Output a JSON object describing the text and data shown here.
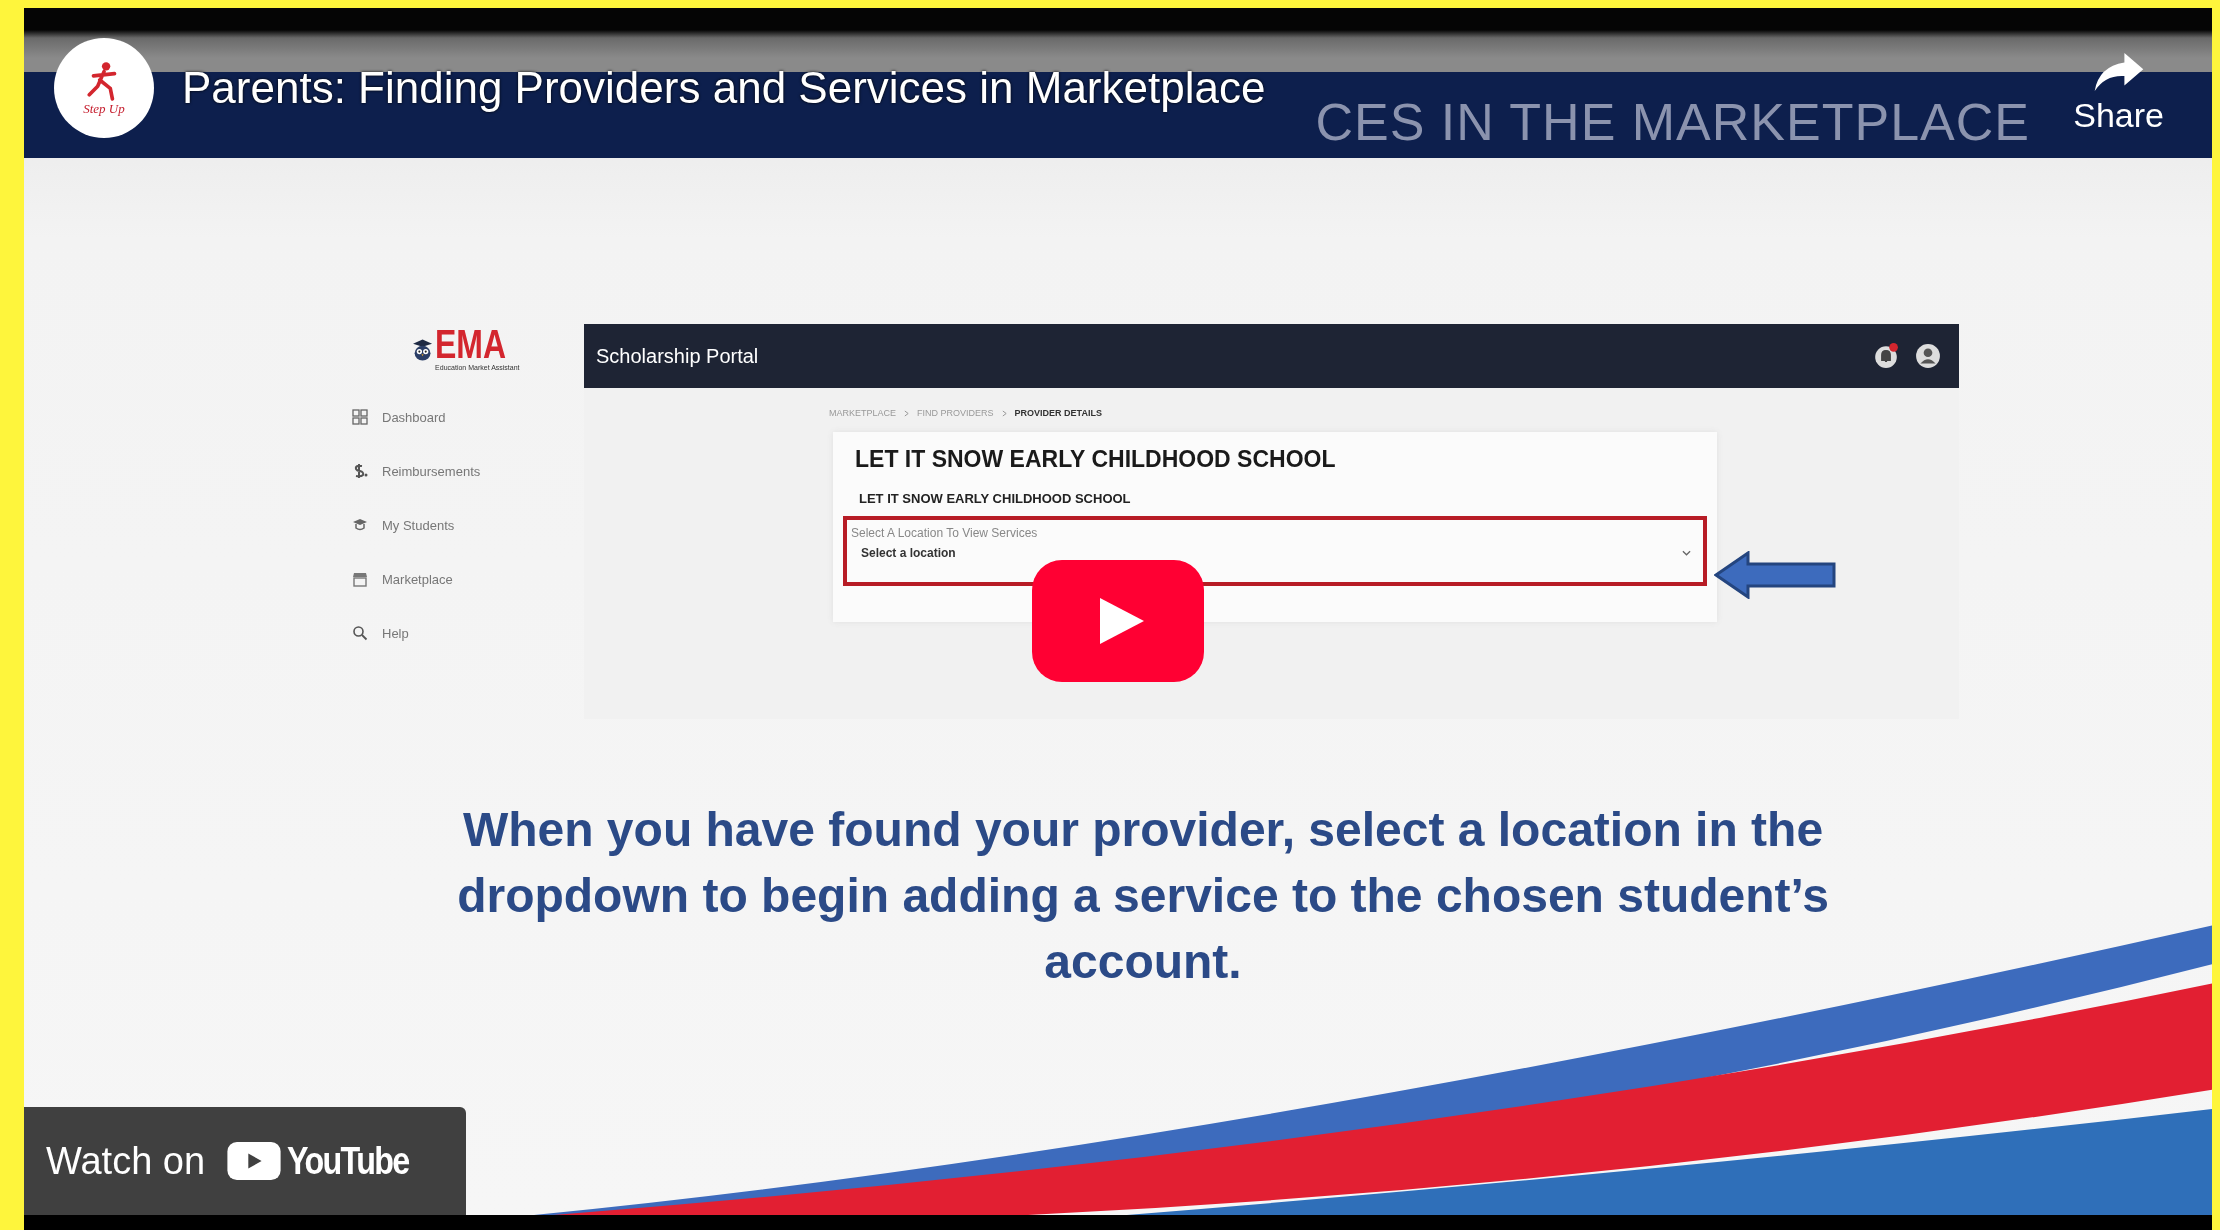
{
  "video": {
    "title": "Parents: Finding Providers and Services in Marketplace",
    "channel_logo_text": "Step Up",
    "share_label": "Share",
    "watch_on_label": "Watch on",
    "youtube_label": "YouTube"
  },
  "slide": {
    "banner_heading": "CES IN THE MARKETPLACE",
    "logo_text": "EMA",
    "logo_tagline": "Education Market Assistant",
    "sidebar": [
      {
        "label": "Dashboard",
        "kind": "dashboard"
      },
      {
        "label": "Reimbursements",
        "kind": "money"
      },
      {
        "label": "My Students",
        "kind": "students"
      },
      {
        "label": "Marketplace",
        "kind": "store"
      },
      {
        "label": "Help",
        "kind": "search"
      }
    ],
    "portal": {
      "title": "Scholarship Portal",
      "notification_badge": true,
      "breadcrumbs": [
        {
          "label": "MARKETPLACE",
          "selected": false
        },
        {
          "label": "FIND PROVIDERS",
          "selected": false
        },
        {
          "label": "PROVIDER DETAILS",
          "selected": true
        }
      ],
      "provider_name": "LET IT SNOW EARLY CHILDHOOD SCHOOL",
      "provider_subtitle": "LET IT SNOW EARLY CHILDHOOD SCHOOL",
      "location_label": "Select A Location To View Services",
      "location_placeholder": "Select a location"
    },
    "caption": "When you have found your provider, select a location in the dropdown to begin adding a service to the chosen student’s account."
  }
}
